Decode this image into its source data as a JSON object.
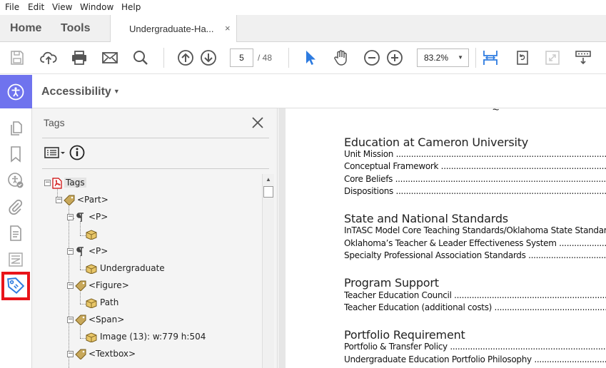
{
  "menu": [
    "File",
    "Edit",
    "View",
    "Window",
    "Help"
  ],
  "tabs": {
    "home": "Home",
    "tools": "Tools",
    "doc_title": "Undergraduate-Ha...",
    "doc_close": "×"
  },
  "toolbar": {
    "page_current": "5",
    "page_total": "/ 48",
    "zoom": "83.2%",
    "icons": [
      "save-icon",
      "upload-icon",
      "print-icon",
      "email-icon",
      "search-icon",
      "prev-page-icon",
      "next-page-icon",
      "select-cursor-icon",
      "hand-tool-icon",
      "zoom-out-icon",
      "zoom-in-icon",
      "fit-width-icon",
      "rotate-icon",
      "full-screen-icon",
      "read-mode-icon"
    ]
  },
  "accessibility": {
    "label": "Accessibility"
  },
  "rail_icons": [
    "pages-icon",
    "bookmark-icon",
    "accessibility-check-icon",
    "attachment-icon",
    "document-icon",
    "content-order-icon",
    "tag-icon"
  ],
  "tags_panel": {
    "title": "Tags",
    "tree": [
      {
        "label": "Tags",
        "icon": "pdf-icon",
        "level": 0
      },
      {
        "label": "<Part>",
        "icon": "tag-icon",
        "level": 1
      },
      {
        "label": "<P>",
        "icon": "paragraph-icon",
        "level": 2
      },
      {
        "label": "",
        "icon": "content-box-icon",
        "level": 3
      },
      {
        "label": "<P>",
        "icon": "paragraph-icon",
        "level": 2
      },
      {
        "label": "Undergraduate",
        "icon": "content-box-icon",
        "level": 3
      },
      {
        "label": "<Figure>",
        "icon": "tag-icon",
        "level": 2
      },
      {
        "label": "Path",
        "icon": "content-box-icon",
        "level": 3
      },
      {
        "label": "<Span>",
        "icon": "tag-icon",
        "level": 2
      },
      {
        "label": "Image (13): w:779 h:504",
        "icon": "content-box-icon",
        "level": 3
      },
      {
        "label": "<Textbox>",
        "icon": "tag-icon",
        "level": 2
      }
    ]
  },
  "document": {
    "sections": [
      {
        "title": "Education at Cameron University",
        "lines": [
          "Unit Mission",
          "Conceptual Framework",
          "Core Beliefs",
          "Dispositions"
        ]
      },
      {
        "title": "State and National Standards",
        "lines": [
          "InTASC Model Core Teaching Standards/Oklahoma State Standards",
          "Oklahoma’s Teacher & Leader Effectiveness System",
          "Specialty Professional Association Standards"
        ]
      },
      {
        "title": "Program Support",
        "lines": [
          "Teacher Education Council",
          "Teacher Education (additional costs)"
        ]
      },
      {
        "title": "Portfolio Requirement",
        "lines": [
          "Portfolio & Transfer Policy",
          "Undergraduate Education Portfolio Philosophy"
        ]
      }
    ]
  },
  "colors": {
    "accent_blue": "#2d7be0",
    "acc_purple": "#6f73ee",
    "selection_red": "#e8141a"
  }
}
